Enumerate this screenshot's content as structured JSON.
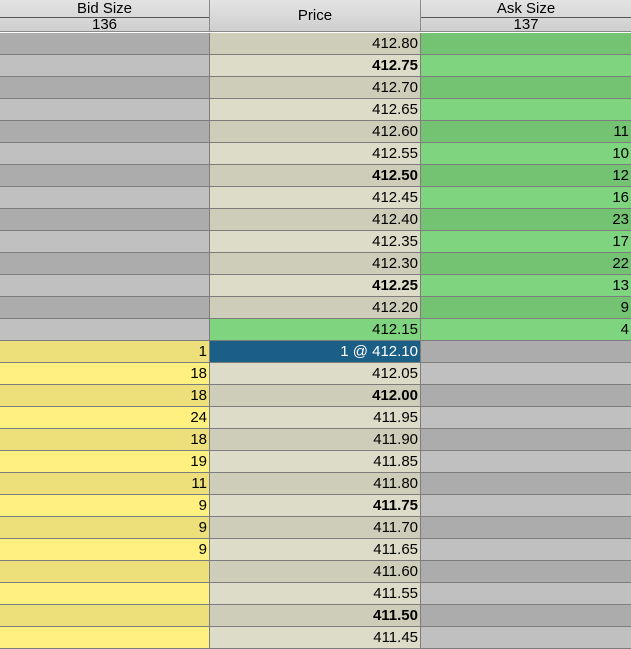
{
  "header": {
    "bid_label": "Bid Size",
    "bid_total": "136",
    "price_label": "Price",
    "ask_label": "Ask Size",
    "ask_total": "137"
  },
  "colors": {
    "bid_light": "#fff07f",
    "bid_dark": "#ede07a",
    "ask_light": "#7fd47f",
    "ask_dark": "#73c373",
    "empty_light": "#c0c0c0",
    "empty_dark": "#acacac",
    "price_light": "#dcdcc8",
    "price_dark": "#cdcdb9",
    "last_trade": "#7fd47f",
    "current": "#1b5e86"
  },
  "rows": [
    {
      "bid": "",
      "price": "412.80",
      "ask": "",
      "bold": false
    },
    {
      "bid": "",
      "price": "412.75",
      "ask": "",
      "bold": true
    },
    {
      "bid": "",
      "price": "412.70",
      "ask": "",
      "bold": false
    },
    {
      "bid": "",
      "price": "412.65",
      "ask": "",
      "bold": false
    },
    {
      "bid": "",
      "price": "412.60",
      "ask": "11",
      "bold": false
    },
    {
      "bid": "",
      "price": "412.55",
      "ask": "10",
      "bold": false
    },
    {
      "bid": "",
      "price": "412.50",
      "ask": "12",
      "bold": true
    },
    {
      "bid": "",
      "price": "412.45",
      "ask": "16",
      "bold": false
    },
    {
      "bid": "",
      "price": "412.40",
      "ask": "23",
      "bold": false
    },
    {
      "bid": "",
      "price": "412.35",
      "ask": "17",
      "bold": false
    },
    {
      "bid": "",
      "price": "412.30",
      "ask": "22",
      "bold": false
    },
    {
      "bid": "",
      "price": "412.25",
      "ask": "13",
      "bold": true
    },
    {
      "bid": "",
      "price": "412.20",
      "ask": "9",
      "bold": false
    },
    {
      "bid": "",
      "price": "412.15",
      "ask": "4",
      "bold": false,
      "price_highlight": true
    },
    {
      "bid": "1",
      "price": "1 @ 412.10",
      "ask": "",
      "bold": false,
      "current": true
    },
    {
      "bid": "18",
      "price": "412.05",
      "ask": "",
      "bold": false
    },
    {
      "bid": "18",
      "price": "412.00",
      "ask": "",
      "bold": true
    },
    {
      "bid": "24",
      "price": "411.95",
      "ask": "",
      "bold": false
    },
    {
      "bid": "18",
      "price": "411.90",
      "ask": "",
      "bold": false
    },
    {
      "bid": "19",
      "price": "411.85",
      "ask": "",
      "bold": false
    },
    {
      "bid": "11",
      "price": "411.80",
      "ask": "",
      "bold": false
    },
    {
      "bid": "9",
      "price": "411.75",
      "ask": "",
      "bold": true
    },
    {
      "bid": "9",
      "price": "411.70",
      "ask": "",
      "bold": false
    },
    {
      "bid": "9",
      "price": "411.65",
      "ask": "",
      "bold": false
    },
    {
      "bid": "",
      "price": "411.60",
      "ask": "",
      "bold": false
    },
    {
      "bid": "",
      "price": "411.55",
      "ask": "",
      "bold": false
    },
    {
      "bid": "",
      "price": "411.50",
      "ask": "",
      "bold": true
    },
    {
      "bid": "",
      "price": "411.45",
      "ask": "",
      "bold": false
    }
  ]
}
